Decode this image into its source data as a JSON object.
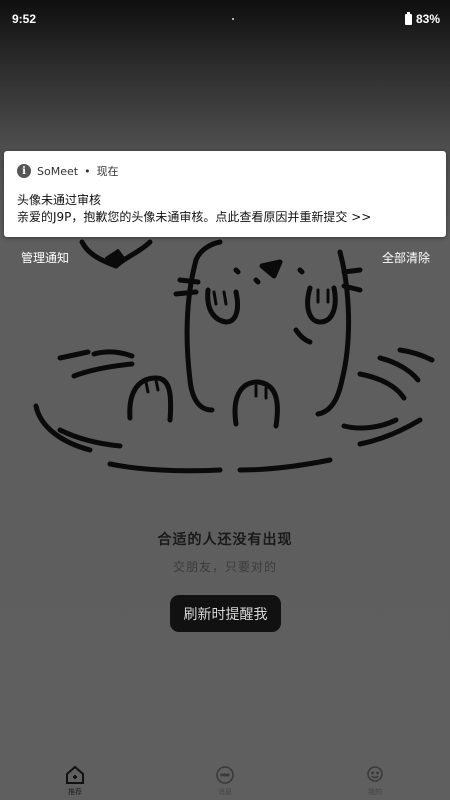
{
  "status_bar": {
    "time": "9:52",
    "battery": "83%"
  },
  "notification": {
    "app_name": "SoMeet",
    "separator": "•",
    "when": "现在",
    "title": "头像未通过审核",
    "body": "亲爱的J9P，抱歉您的头像未通审核。点此查看原因并重新提交 >>",
    "icon": "info-icon"
  },
  "actions": {
    "manage": "管理通知",
    "clear_all": "全部清除"
  },
  "empty_state": {
    "title": "合适的人还没有出现",
    "subtitle": "交朋友，只要对的",
    "refresh_button": "刷新时提醒我",
    "illustration": "otter-in-water-illustration"
  },
  "tab_bar": {
    "items": [
      {
        "label": "推荐",
        "icon": "home-icon",
        "active": true
      },
      {
        "label": "消息",
        "icon": "chat-icon",
        "active": false
      },
      {
        "label": "我的",
        "icon": "profile-icon",
        "active": false
      }
    ]
  },
  "colors": {
    "notification_bg": "#ffffff",
    "button_bg": "#111111",
    "overlay": "#5f5f5f"
  }
}
